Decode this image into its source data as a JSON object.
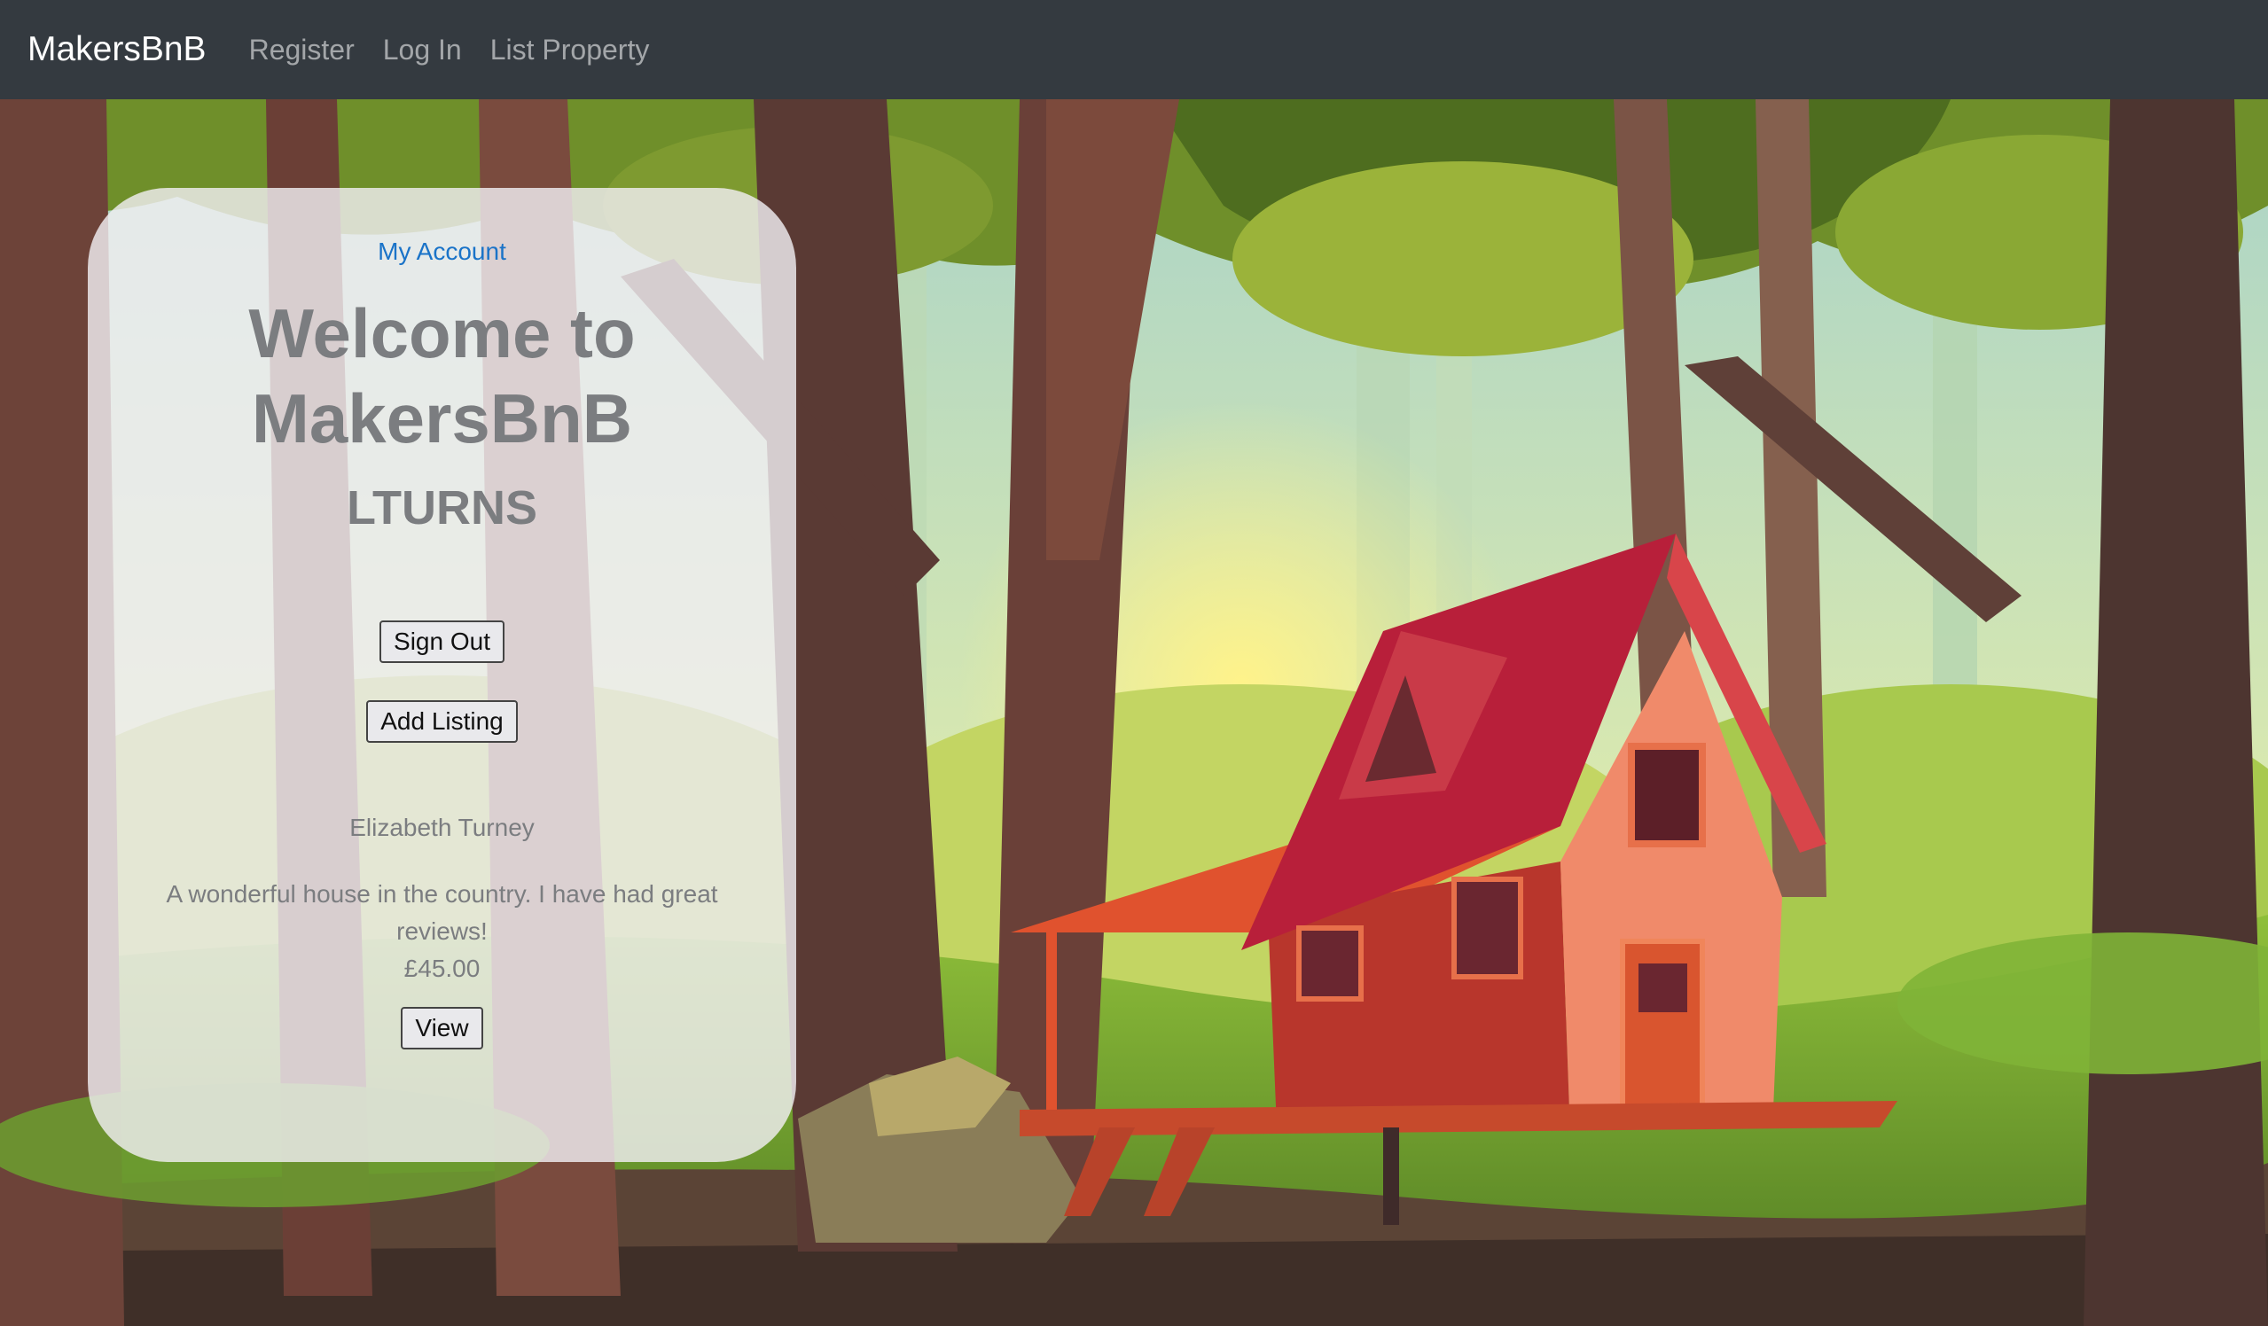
{
  "navbar": {
    "brand": "MakersBnB",
    "links": [
      {
        "label": "Register"
      },
      {
        "label": "Log In"
      },
      {
        "label": "List Property"
      }
    ]
  },
  "card": {
    "account_link": "My Account",
    "welcome_title": "Welcome to MakersBnB",
    "username": "LTURNS",
    "sign_out_label": "Sign Out",
    "add_listing_label": "Add Listing",
    "listing": {
      "owner": "Elizabeth Turney",
      "description": "A wonderful house in the country. I have had great reviews!",
      "price": "£45.00",
      "view_label": "View"
    }
  },
  "colors": {
    "navbar_bg": "#343a40",
    "link_blue": "#1a73c8",
    "card_text": "#7b7d80"
  }
}
